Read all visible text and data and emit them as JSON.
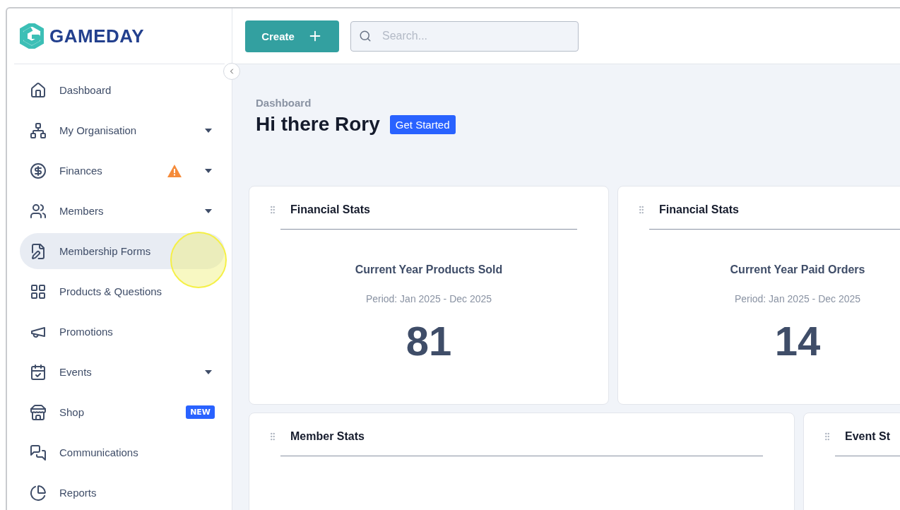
{
  "logo": {
    "text": "GAMEDAY"
  },
  "sidebar": {
    "items": [
      {
        "label": "Dashboard",
        "selected": false,
        "expandable": false
      },
      {
        "label": "My Organisation",
        "selected": false,
        "expandable": true
      },
      {
        "label": "Finances",
        "selected": false,
        "expandable": true,
        "warning": true
      },
      {
        "label": "Members",
        "selected": false,
        "expandable": true
      },
      {
        "label": "Membership Forms",
        "selected": true,
        "expandable": false
      },
      {
        "label": "Products & Questions",
        "selected": false,
        "expandable": false
      },
      {
        "label": "Promotions",
        "selected": false,
        "expandable": false
      },
      {
        "label": "Events",
        "selected": false,
        "expandable": true
      },
      {
        "label": "Shop",
        "selected": false,
        "expandable": false,
        "badge": "NEW"
      },
      {
        "label": "Communications",
        "selected": false,
        "expandable": false
      },
      {
        "label": "Reports",
        "selected": false,
        "expandable": false
      }
    ]
  },
  "topbar": {
    "create_button": "Create",
    "search": {
      "placeholder": "Search..."
    }
  },
  "header": {
    "breadcrumb": "Dashboard",
    "greeting": "Hi there Rory",
    "action": "Get Started"
  },
  "cards": [
    {
      "kind": "stat",
      "title": "Financial Stats",
      "metric": "Current Year Products Sold",
      "period": "Period: Jan 2025 - Dec 2025",
      "value": "81"
    },
    {
      "kind": "stat",
      "title": "Financial Stats",
      "metric": "Current Year Paid Orders",
      "period": "Period: Jan 2025 - Dec 2025",
      "value": "14"
    },
    {
      "kind": "wide",
      "title": "Member Stats"
    },
    {
      "kind": "wide",
      "title": "Event St"
    }
  ]
}
